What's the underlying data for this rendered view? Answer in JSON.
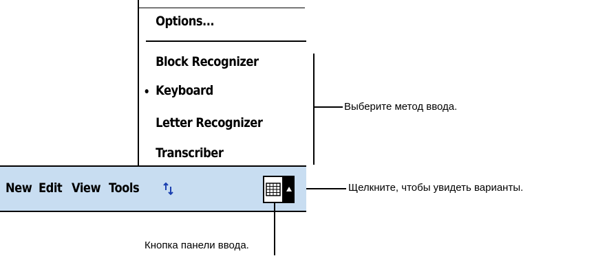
{
  "input_menu": {
    "options_label": "Options...",
    "items": [
      {
        "label": "Block Recognizer",
        "selected": false
      },
      {
        "label": "Keyboard",
        "selected": true
      },
      {
        "label": "Letter Recognizer",
        "selected": false
      },
      {
        "label": "Transcriber",
        "selected": false
      }
    ]
  },
  "menubar": {
    "items": [
      "New",
      "Edit",
      "View",
      "Tools"
    ],
    "updown_icon": "up-down-arrows-icon",
    "input_panel_icon": "keyboard-icon",
    "input_arrow_icon": "up-arrow-icon",
    "background_color": "#c8ddf1"
  },
  "callouts": {
    "choose_method": "Выберите метод ввода.",
    "tap_arrow": "Щелкните, чтобы увидеть варианты.",
    "input_panel_button": "Кнопка панели ввода."
  }
}
